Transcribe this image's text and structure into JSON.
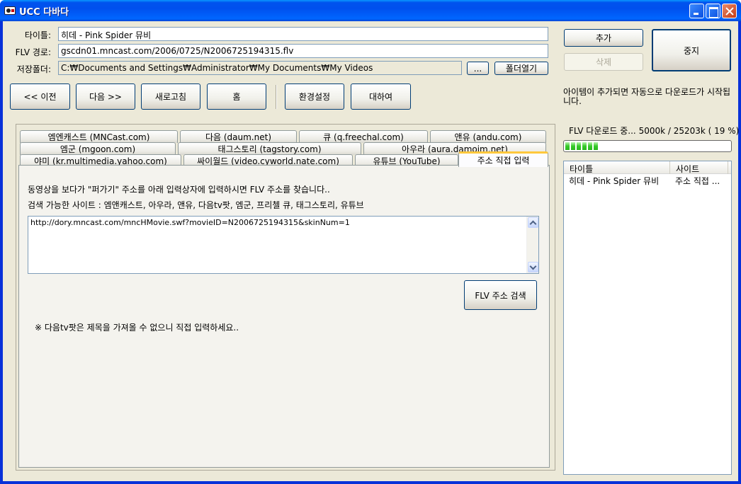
{
  "window": {
    "title": "UCC 다바다"
  },
  "form": {
    "title_label": "타이틀:",
    "title_value": "히데 - Pink Spider 뮤비",
    "flv_label": "FLV 경로:",
    "flv_value": "gscdn01.mncast.com/2006/0725/N2006725194315.flv",
    "folder_label": "저장폴더:",
    "folder_value": "C:₩Documents and Settings₩Administrator₩My Documents₩My Videos",
    "browse_label": "...",
    "open_folder_label": "폴더열기"
  },
  "actions": {
    "add": "추가",
    "delete": "삭제",
    "stop": "중지"
  },
  "toolbar": {
    "prev": "<< 이전",
    "next": "다음 >>",
    "refresh": "새로고침",
    "home": "홈",
    "settings": "환경설정",
    "about": "대하여"
  },
  "auto_note": "아이템이 추가되면 자동으로 다운로드가 시작됩니다.",
  "tabs": {
    "row1": [
      "엠엔캐스트 (MNCast.com)",
      "다음 (daum.net)",
      "큐 (q.freechal.com)",
      "앤유 (andu.com)"
    ],
    "row2": [
      "엠군 (mgoon.com)",
      "태그스토리 (tagstory.com)",
      "아우라 (aura.damoim.net)"
    ],
    "row3": [
      "야미 (kr.multimedia.yahoo.com)",
      "싸이월드 (video.cyworld.nate.com)",
      "유튜브 (YouTube)",
      "주소 직접 입력"
    ],
    "active": "주소 직접 입력"
  },
  "panel": {
    "instruction": "동영상을 보다가 \"퍼가기\" 주소를 아래 입력상자에 입력하시면 FLV 주소를 찾습니다..",
    "sites": "검색 가능한 사이트 : 엠앤캐스트, 아우라, 앤유, 다음tv팟, 엠군, 프리첼 큐, 태그스토리, 유튜브",
    "url_value": "http://dory.mncast.com/mncHMovie.swf?movieID=N2006725194315&skinNum=1",
    "search_button": "FLV 주소 검색",
    "note": "※ 다음tv팟은 제목을 가져올 수 없으니 직접 입력하세요.."
  },
  "download": {
    "status": "FLV 다운로드 중... 5000k / 25203k ( 19 %)",
    "progress_fraction": 0.19
  },
  "queue": {
    "columns": [
      "타이틀",
      "사이트"
    ],
    "rows": [
      [
        "히데 - Pink Spider 뮤비",
        "주소 직접 ..."
      ]
    ]
  }
}
